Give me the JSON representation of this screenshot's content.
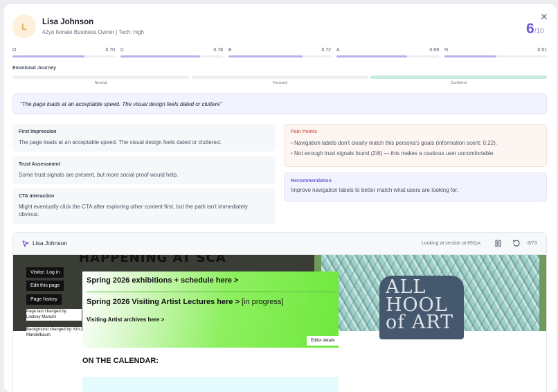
{
  "persona": {
    "initial": "L",
    "name": "Lisa Johnson",
    "description": "42yo female Business Owner | Tech: high",
    "score": "6",
    "score_denominator": "/10",
    "avatar_color": "#fdf1dc"
  },
  "traits": [
    {
      "label": "O",
      "value": "0.70",
      "level": 0.7
    },
    {
      "label": "C",
      "value": "0.78",
      "level": 0.78
    },
    {
      "label": "E",
      "value": "0.72",
      "level": 0.72
    },
    {
      "label": "A",
      "value": "0.69",
      "level": 0.69
    },
    {
      "label": "N",
      "value": "0.51",
      "level": 0.51
    }
  ],
  "emotional_journey": {
    "title": "Emotional Journey",
    "stages": [
      {
        "label": "Neutral",
        "color": "#eeeff2"
      },
      {
        "label": "Focused",
        "color": "#eeeff2"
      },
      {
        "label": "Confident",
        "color": "#c8ecdc"
      }
    ]
  },
  "quote": "\"The page loads at an acceptable speed. The visual design feels dated or cluttere\"",
  "assessments": [
    {
      "title": "First Impression",
      "body": "The page loads at an acceptable speed. The visual design feels dated or cluttered."
    },
    {
      "title": "Trust Assessment",
      "body": "Some trust signals are present, but more social proof would help."
    },
    {
      "title": "CTA Interaction",
      "body": "Might eventually click the CTA after exploring other content first, but the path isn't immediately obvious."
    }
  ],
  "pain_points": {
    "title": "Pain Points",
    "items": [
      "Navigation labels don't clearly match this persona's goals (information scent: 0.22).",
      "Not enough trust signals found (2/6) — this makes a cautious user uncomfortable."
    ]
  },
  "recommendation": {
    "title": "Recommendation",
    "body": "Improve navigation labels to better match what users are looking for."
  },
  "browser": {
    "persona_name": "Lisa Johnson",
    "status": "Looking at section at 692px",
    "page": "8/73"
  },
  "site": {
    "heading_partial": "HAPPENING AT SCA",
    "chair_text": "ALL HOOL of ART",
    "admin_buttons": [
      "Visitor: Log in",
      "Edit this page",
      "Page history"
    ],
    "page_changed": "Page last changed by: Lindsey Mancini",
    "background_changed": "Background changed by: Kris Mandelbaum",
    "links": [
      "Spring 2026 exhibitions + schedule here >",
      "Spring 2026 Visiting Artist Lectures here >",
      "Visiting Artist archives here >"
    ],
    "link_suffix": " [in progress]",
    "editor_details": "Editor details",
    "calendar_heading": "ON THE CALENDAR:"
  },
  "colors": {
    "accent": "#6b5bd3",
    "trait_fill": "#b8b0ec",
    "pain_accent": "#d0705a",
    "green_panel": "#6fe83d"
  }
}
